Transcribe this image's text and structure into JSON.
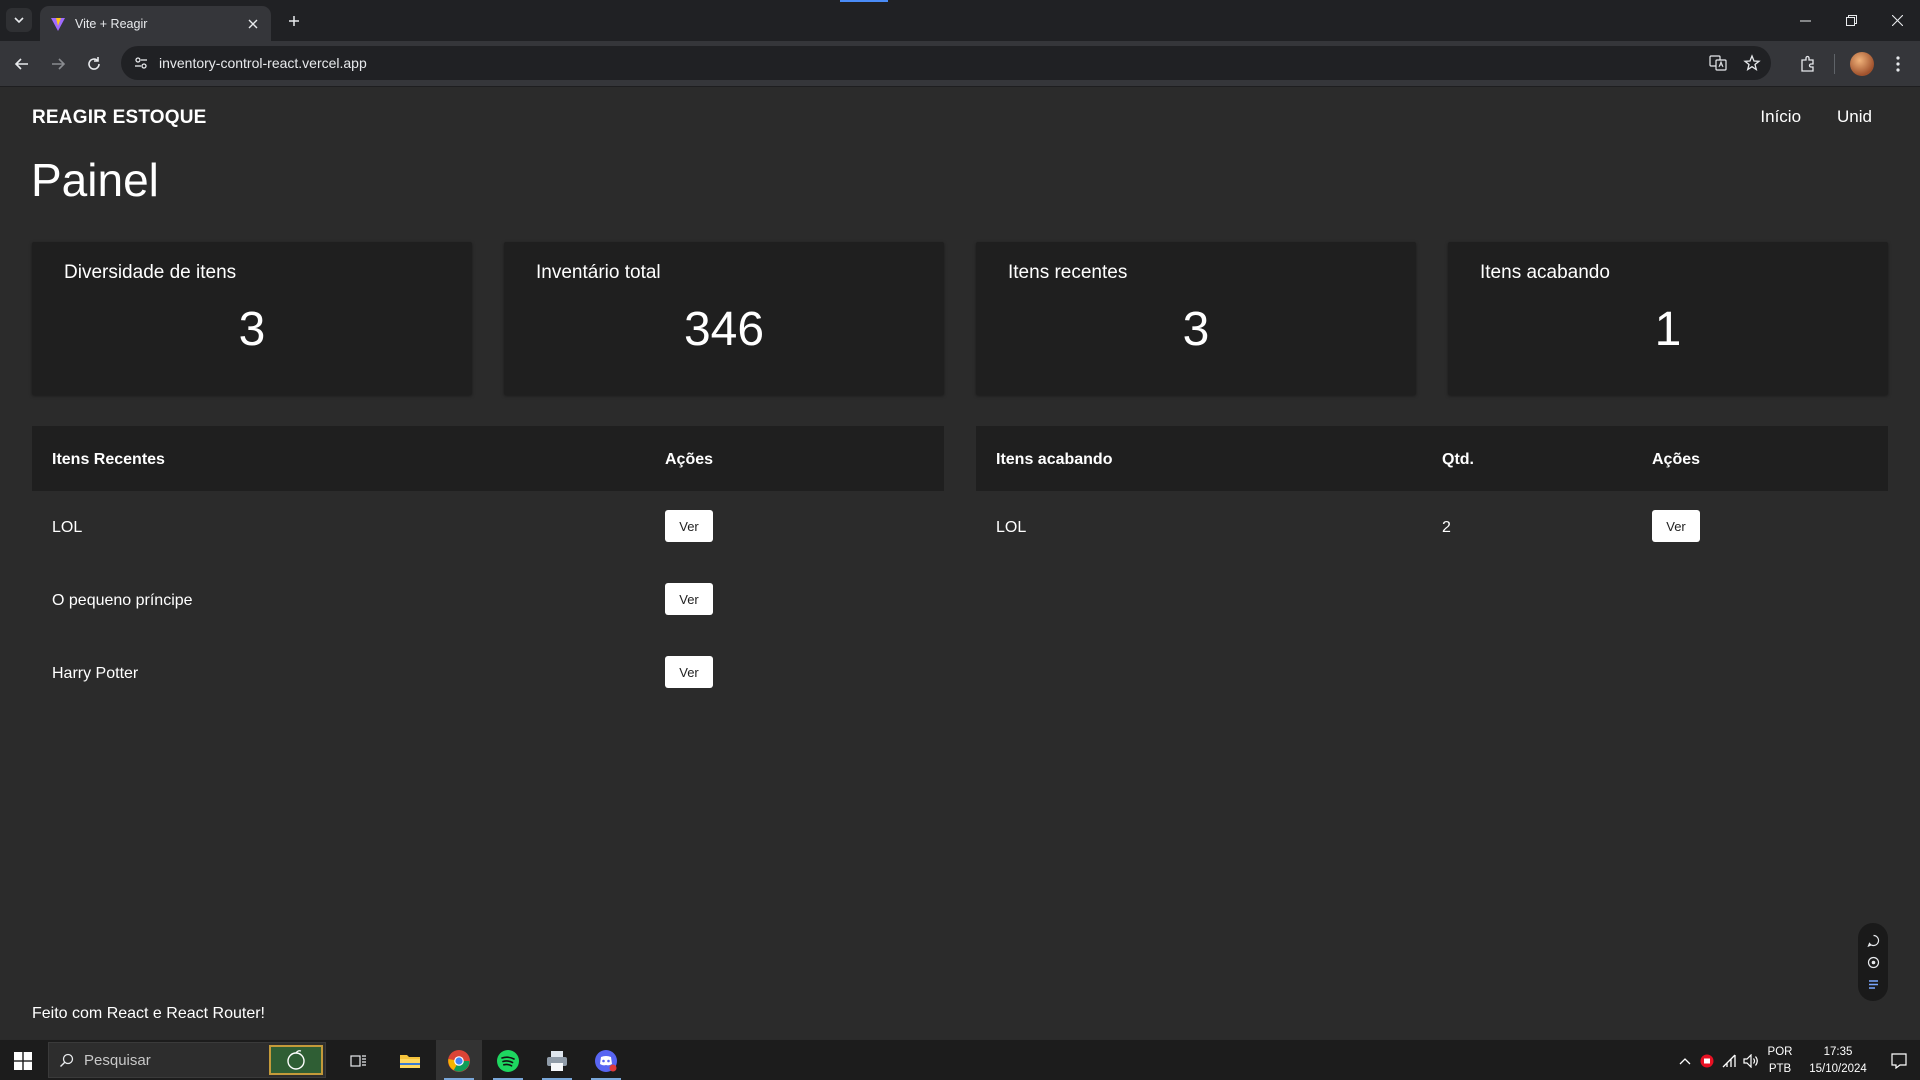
{
  "browser": {
    "tab_title": "Vite + Reagir",
    "url": "inventory-control-react.vercel.app"
  },
  "app": {
    "brand": "REAGIR ESTOQUE",
    "nav": [
      "Início",
      "Unid"
    ],
    "page_title": "Painel"
  },
  "stats": [
    {
      "label": "Diversidade de itens",
      "value": "3"
    },
    {
      "label": "Inventário total",
      "value": "346"
    },
    {
      "label": "Itens recentes",
      "value": "3"
    },
    {
      "label": "Itens acabando",
      "value": "1"
    }
  ],
  "recent_table": {
    "headers": [
      "Itens Recentes",
      "Ações"
    ],
    "rows": [
      {
        "name": "LOL",
        "action": "Ver"
      },
      {
        "name": "O pequeno príncipe",
        "action": "Ver"
      },
      {
        "name": "Harry Potter",
        "action": "Ver"
      }
    ]
  },
  "low_table": {
    "headers": [
      "Itens acabando",
      "Qtd.",
      "Ações"
    ],
    "rows": [
      {
        "name": "LOL",
        "qty": "2",
        "action": "Ver"
      }
    ]
  },
  "footer": "Feito com React e React Router!",
  "taskbar": {
    "search_placeholder": "Pesquisar",
    "lang_top": "POR",
    "lang_bottom": "PTB",
    "time": "17:35",
    "date": "15/10/2024"
  },
  "colors": {
    "page_bg": "#2b2b2b",
    "card_bg": "#1f1f1f",
    "chrome_bg": "#202124",
    "toolbar_bg": "#35363a"
  }
}
